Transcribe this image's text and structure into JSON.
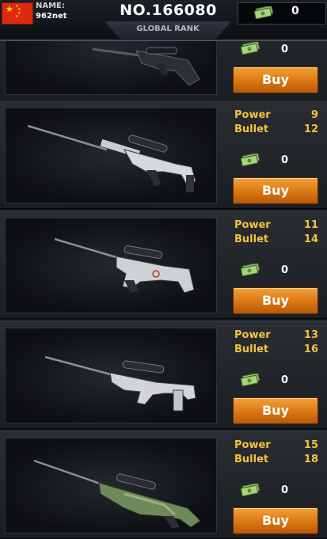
{
  "header": {
    "name_label": "NAME:",
    "player_name": "962net",
    "rank_number": "NO.166080",
    "rank_label": "GLOBAL RANK",
    "coins": "0"
  },
  "icons": {
    "flag": "china-flag-icon",
    "currency": "cash-stack-icon"
  },
  "colors": {
    "stat_text": "#f5c23a",
    "buy_button": "#dd7a15",
    "flag_red": "#de2910",
    "flag_star": "#ffde00"
  },
  "weapons": [
    {
      "price": "0",
      "buy_label": "Buy"
    },
    {
      "power_label": "Power",
      "power": "9",
      "bullet_label": "Bullet",
      "bullet": "12",
      "price": "0",
      "buy_label": "Buy"
    },
    {
      "power_label": "Power",
      "power": "11",
      "bullet_label": "Bullet",
      "bullet": "14",
      "price": "0",
      "buy_label": "Buy"
    },
    {
      "power_label": "Power",
      "power": "13",
      "bullet_label": "Bullet",
      "bullet": "16",
      "price": "0",
      "buy_label": "Buy"
    },
    {
      "power_label": "Power",
      "power": "15",
      "bullet_label": "Bullet",
      "bullet": "18",
      "price": "0",
      "buy_label": "Buy"
    }
  ]
}
